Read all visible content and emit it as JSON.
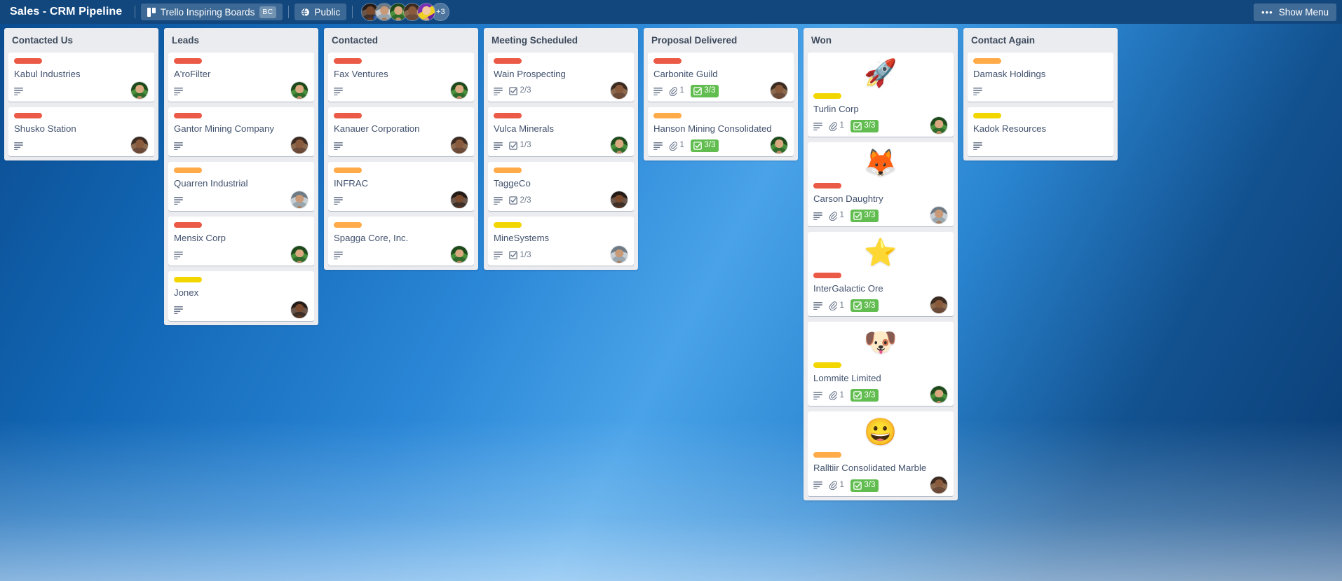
{
  "header": {
    "board_title": "Sales - CRM Pipeline",
    "team_name": "Trello Inspiring Boards",
    "team_badge": "BC",
    "visibility": "Public",
    "members_overflow": "+3",
    "show_menu_label": "Show Menu",
    "dots_glyph": "•••",
    "icons": {
      "trello_logo": "trello-logo-icon",
      "globe": "globe-icon"
    }
  },
  "colors": {
    "label_red": "#eb5a46",
    "label_orange": "#ffab4a",
    "label_yellow": "#f2d600",
    "badge_green": "#61bd4f",
    "board_bg_accent": "#2a86d6",
    "header_bg": "#12477e",
    "list_bg": "#ebecf0",
    "card_bg": "#ffffff",
    "text_color": "#42526e"
  },
  "lists": [
    {
      "title": "Contacted Us",
      "cards": [
        {
          "title": "Kabul Industries",
          "label": "red",
          "description": true,
          "attachments": null,
          "checklist": null,
          "cover": null,
          "avatar": "ph-a"
        },
        {
          "title": "Shusko Station",
          "label": "red",
          "description": true,
          "attachments": null,
          "checklist": null,
          "cover": null,
          "avatar": "ph-b"
        }
      ]
    },
    {
      "title": "Leads",
      "cards": [
        {
          "title": "A'roFilter",
          "label": "red",
          "description": true,
          "attachments": null,
          "checklist": null,
          "cover": null,
          "avatar": "ph-a"
        },
        {
          "title": "Gantor Mining Company",
          "label": "red",
          "description": true,
          "attachments": null,
          "checklist": null,
          "cover": null,
          "avatar": "ph-b"
        },
        {
          "title": "Quarren Industrial",
          "label": "orange",
          "description": true,
          "attachments": null,
          "checklist": null,
          "cover": null,
          "avatar": "ph-c"
        },
        {
          "title": "Mensix Corp",
          "label": "red",
          "description": true,
          "attachments": null,
          "checklist": null,
          "cover": null,
          "avatar": "ph-a"
        },
        {
          "title": "Jonex",
          "label": "yellow",
          "description": true,
          "attachments": null,
          "checklist": null,
          "cover": null,
          "avatar": "ph-d"
        }
      ]
    },
    {
      "title": "Contacted",
      "cards": [
        {
          "title": "Fax Ventures",
          "label": "red",
          "description": true,
          "attachments": null,
          "checklist": null,
          "cover": null,
          "avatar": "ph-a"
        },
        {
          "title": "Kanauer Corporation",
          "label": "red",
          "description": true,
          "attachments": null,
          "checklist": null,
          "cover": null,
          "avatar": "ph-b"
        },
        {
          "title": "INFRAC",
          "label": "orange",
          "description": true,
          "attachments": null,
          "checklist": null,
          "cover": null,
          "avatar": "ph-d"
        },
        {
          "title": "Spagga Core, Inc.",
          "label": "orange",
          "description": true,
          "attachments": null,
          "checklist": null,
          "cover": null,
          "avatar": "ph-a"
        }
      ]
    },
    {
      "title": "Meeting Scheduled",
      "cards": [
        {
          "title": "Wain Prospecting",
          "label": "red",
          "description": true,
          "attachments": null,
          "checklist": "2/3",
          "checklist_done": false,
          "cover": null,
          "avatar": "ph-b"
        },
        {
          "title": "Vulca Minerals",
          "label": "red",
          "description": true,
          "attachments": null,
          "checklist": "1/3",
          "checklist_done": false,
          "cover": null,
          "avatar": "ph-a"
        },
        {
          "title": "TaggeCo",
          "label": "orange",
          "description": true,
          "attachments": null,
          "checklist": "2/3",
          "checklist_done": false,
          "cover": null,
          "avatar": "ph-d"
        },
        {
          "title": "MineSystems",
          "label": "yellow",
          "description": true,
          "attachments": null,
          "checklist": "1/3",
          "checklist_done": false,
          "cover": null,
          "avatar": "ph-c"
        }
      ]
    },
    {
      "title": "Proposal Delivered",
      "cards": [
        {
          "title": "Carbonite Guild",
          "label": "red",
          "description": true,
          "attachments": "1",
          "checklist": "3/3",
          "checklist_done": true,
          "cover": null,
          "avatar": "ph-b"
        },
        {
          "title": "Hanson Mining Consolidated",
          "label": "orange",
          "description": true,
          "attachments": "1",
          "checklist": "3/3",
          "checklist_done": true,
          "cover": null,
          "avatar": "ph-a"
        }
      ]
    },
    {
      "title": "Won",
      "cards": [
        {
          "title": "Turlin Corp",
          "label": "yellow",
          "description": true,
          "attachments": "1",
          "checklist": "3/3",
          "checklist_done": true,
          "cover": "🚀",
          "cover_name": "rocket-sticker",
          "avatar": "ph-a"
        },
        {
          "title": "Carson Daughtry",
          "label": "red",
          "description": true,
          "attachments": "1",
          "checklist": "3/3",
          "checklist_done": true,
          "cover": "🦊",
          "cover_name": "fox-sticker",
          "avatar": "ph-c"
        },
        {
          "title": "InterGalactic Ore",
          "label": "red",
          "description": true,
          "attachments": "1",
          "checklist": "3/3",
          "checklist_done": true,
          "cover": "⭐",
          "cover_name": "star-sticker",
          "avatar": "ph-b"
        },
        {
          "title": "Lommite Limited",
          "label": "yellow",
          "description": true,
          "attachments": "1",
          "checklist": "3/3",
          "checklist_done": true,
          "cover": "🐶",
          "cover_name": "money-dog-sticker",
          "avatar": "ph-a"
        },
        {
          "title": "Ralltiir Consolidated Marble",
          "label": "orange",
          "description": true,
          "attachments": "1",
          "checklist": "3/3",
          "checklist_done": true,
          "cover": "😀",
          "cover_name": "smiley-sticker",
          "avatar": "ph-b"
        }
      ]
    },
    {
      "title": "Contact Again",
      "cards": [
        {
          "title": "Damask Holdings",
          "label": "orange",
          "description": true,
          "attachments": null,
          "checklist": null,
          "cover": null,
          "avatar": null
        },
        {
          "title": "Kadok Resources",
          "label": "yellow",
          "description": true,
          "attachments": null,
          "checklist": null,
          "cover": null,
          "avatar": null
        }
      ]
    }
  ]
}
